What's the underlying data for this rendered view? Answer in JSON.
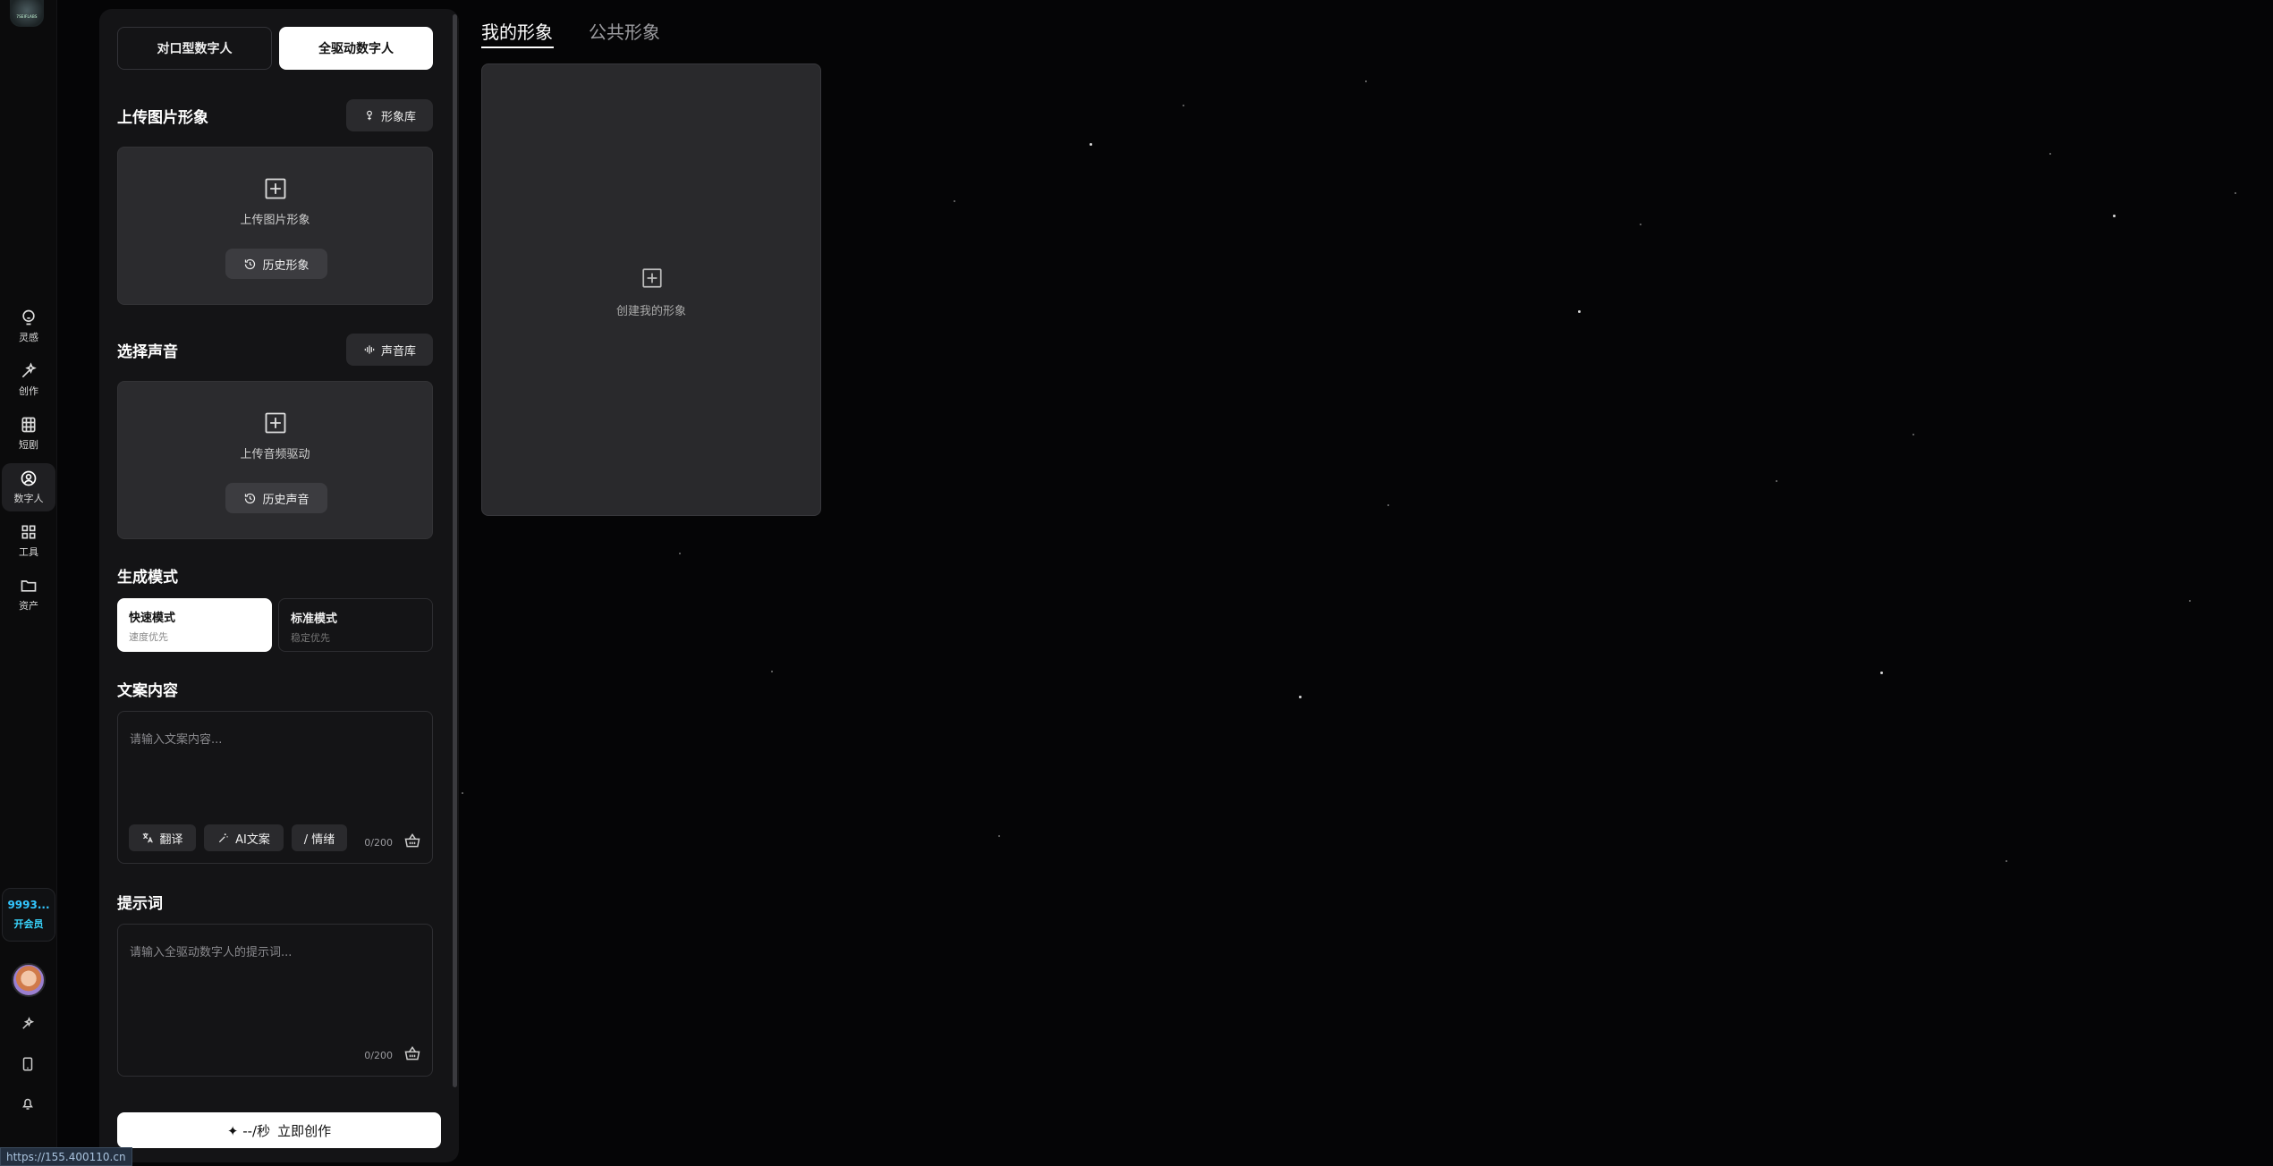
{
  "sidebar": {
    "logo_text": "7SEIFLABS",
    "items": [
      {
        "label": "灵感",
        "icon": "bulb-icon"
      },
      {
        "label": "创作",
        "icon": "sparkle-wand-icon"
      },
      {
        "label": "短剧",
        "icon": "film-icon"
      },
      {
        "label": "数字人",
        "icon": "person-icon",
        "active": true
      },
      {
        "label": "工具",
        "icon": "grid-icon"
      },
      {
        "label": "资产",
        "icon": "folder-icon"
      }
    ],
    "credits": "9993...",
    "vip_label": "开会员"
  },
  "panel": {
    "tabs": [
      "对口型数字人",
      "全驱动数字人"
    ],
    "active_tab": "全驱动数字人",
    "image_section": {
      "title": "上传图片形象",
      "library_button": "形象库",
      "upload_text": "上传图片形象",
      "history_button": "历史形象"
    },
    "voice_section": {
      "title": "选择声音",
      "library_button": "声音库",
      "upload_text": "上传音频驱动",
      "history_button": "历史声音"
    },
    "mode_section": {
      "title": "生成模式",
      "modes": [
        {
          "title": "快速模式",
          "sub": "速度优先"
        },
        {
          "title": "标准模式",
          "sub": "稳定优先"
        }
      ]
    },
    "script_section": {
      "title": "文案内容",
      "placeholder": "请输入文案内容...",
      "tools": [
        "翻译",
        "AI文案",
        "/ 情绪"
      ],
      "counter": "0/200"
    },
    "prompt_section": {
      "title": "提示词",
      "placeholder": "请输入全驱动数字人的提示词...",
      "counter": "0/200"
    },
    "create_button": {
      "cost": "✦ --/秒",
      "label": "立即创作"
    }
  },
  "main": {
    "tabs": [
      "我的形象",
      "公共形象"
    ],
    "card_label": "创建我的形象"
  },
  "status_bar": "https://155.400110.cn",
  "colors": {
    "accent": "#33c6ff",
    "background": "#050506",
    "panel": "#141416"
  }
}
